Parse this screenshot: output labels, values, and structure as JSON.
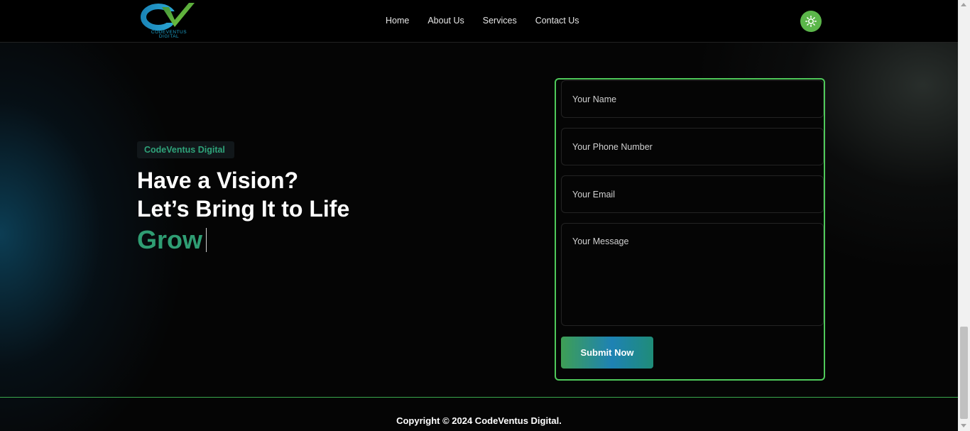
{
  "header": {
    "logo_text": "CODEVENTUS DIGITAL",
    "nav": [
      {
        "label": "Home"
      },
      {
        "label": "About Us"
      },
      {
        "label": "Services"
      },
      {
        "label": "Contact Us"
      }
    ],
    "theme_toggle_icon": "sun-icon"
  },
  "hero": {
    "badge": "CodeVentus Digital",
    "title_line1": "Have a Vision?",
    "title_line2": "Let’s Bring It to Life",
    "typed_word": "Grow"
  },
  "form": {
    "name_placeholder": "Your Name",
    "phone_placeholder": "Your Phone Number",
    "email_placeholder": "Your Email",
    "message_placeholder": "Your Message",
    "submit_label": "Submit Now"
  },
  "footer": {
    "copyright": "Copyright © 2024 CodeVentus Digital."
  },
  "colors": {
    "accent_green": "#5bb64a",
    "form_border": "#4fc95a",
    "brand_teal": "#2f9d73",
    "brand_blue": "#1e82b4"
  }
}
